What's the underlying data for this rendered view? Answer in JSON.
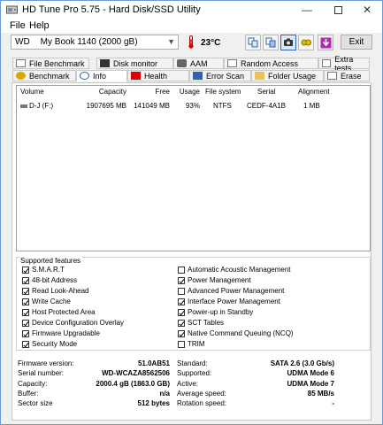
{
  "window": {
    "title": "HD Tune Pro 5.75 - Hard Disk/SSD Utility"
  },
  "menu": [
    {
      "label": "File",
      "key": "F"
    },
    {
      "label": "Help",
      "key": "H"
    }
  ],
  "toolbar": {
    "drive_brand": "WD",
    "drive_name": "My Book 1140 (2000 gB)",
    "temperature": "23°C",
    "exit_label": "Exit"
  },
  "tabs_top": [
    "File Benchmark",
    "Disk monitor",
    "AAM",
    "Random Access",
    "Extra tests"
  ],
  "tabs_bottom": [
    "Benchmark",
    "Info",
    "Health",
    "Error Scan",
    "Folder Usage",
    "Erase"
  ],
  "active_tab": "Info",
  "volumes": {
    "headers": [
      "Volume",
      "Capacity",
      "Free",
      "Usage",
      "File system",
      "Serial",
      "Alignment"
    ],
    "rows": [
      [
        "D-J (F:)",
        "1907695 MB",
        "141049 MB",
        "93%",
        "NTFS",
        "CEDF-4A1B",
        "1 MB"
      ]
    ]
  },
  "features": {
    "title": "Supported features",
    "left": [
      {
        "label": "S.M.A.R.T",
        "checked": true
      },
      {
        "label": "48-bit Address",
        "checked": true
      },
      {
        "label": "Read Look-Ahead",
        "checked": true
      },
      {
        "label": "Write Cache",
        "checked": true
      },
      {
        "label": "Host Protected Area",
        "checked": true
      },
      {
        "label": "Device Configuration Overlay",
        "checked": true
      },
      {
        "label": "Firmware Upgradable",
        "checked": true
      },
      {
        "label": "Security Mode",
        "checked": true
      }
    ],
    "right": [
      {
        "label": "Automatic Acoustic Management",
        "checked": false
      },
      {
        "label": "Power Management",
        "checked": true
      },
      {
        "label": "Advanced Power Management",
        "checked": false
      },
      {
        "label": "Interface Power Management",
        "checked": true
      },
      {
        "label": "Power-up in Standby",
        "checked": true
      },
      {
        "label": "SCT Tables",
        "checked": true
      },
      {
        "label": "Native Command Queuing (NCQ)",
        "checked": true
      },
      {
        "label": "TRIM",
        "checked": false
      }
    ]
  },
  "details": {
    "left": [
      {
        "label": "Firmware version:",
        "value": "51.0AB51"
      },
      {
        "label": "Serial number:",
        "value": "WD-WCAZA8562506"
      },
      {
        "label": "Capacity:",
        "value": "2000.4 gB (1863.0 GB)"
      },
      {
        "label": "Buffer:",
        "value": "n/a"
      },
      {
        "label": "Sector size",
        "value": "512 bytes"
      }
    ],
    "right": [
      {
        "label": "Standard:",
        "value": "SATA 2.6 (3.0 Gb/s)"
      },
      {
        "label": "Supported:",
        "value": "UDMA Mode 6"
      },
      {
        "label": "Active:",
        "value": "UDMA Mode 7"
      },
      {
        "label": "Average speed:",
        "value": "85 MB/s"
      },
      {
        "label": "Rotation speed:",
        "value": "-"
      }
    ]
  },
  "colors": {
    "accent": "#2a64b0",
    "window_border": "#6e9bd1"
  }
}
